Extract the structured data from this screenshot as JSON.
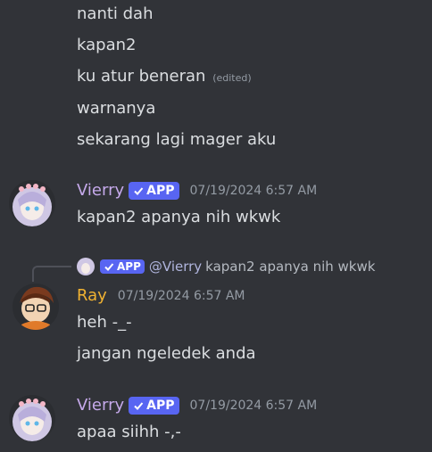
{
  "earlier_lines": [
    {
      "text": "nanti dah"
    },
    {
      "text": "kapan2"
    },
    {
      "text": "ku atur beneran",
      "edited": "(edited)"
    },
    {
      "text": "warnanya"
    },
    {
      "text": "sekarang lagi mager aku"
    }
  ],
  "messages": [
    {
      "author": "Vierry",
      "badge": "APP",
      "timestamp": "07/19/2024 6:57 AM",
      "lines": [
        "kapan2 apanya nih wkwk"
      ]
    },
    {
      "author": "Ray",
      "timestamp": "07/19/2024 6:57 AM",
      "reply": {
        "badge": "APP",
        "mention": "@Vierry",
        "text": "kapan2 apanya nih wkwk"
      },
      "lines": [
        "heh -_-",
        "jangan ngeledek anda"
      ]
    },
    {
      "author": "Vierry",
      "badge": "APP",
      "timestamp": "07/19/2024 6:57 AM",
      "lines": [
        "apaa siihh -,-"
      ]
    }
  ],
  "colors": {
    "background": "#313338",
    "vierry_name": "#c5a9ea",
    "ray_name": "#f0b232",
    "app_badge": "#5865f2"
  }
}
